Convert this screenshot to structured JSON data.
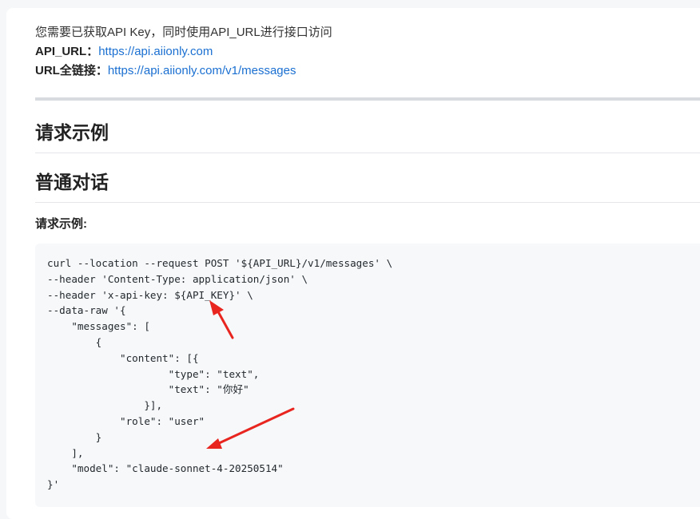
{
  "intro": {
    "line1": "您需要已获取API Key，同时使用API_URL进行接口访问",
    "api_url_label": "API_URL：",
    "api_url_link": "https://api.aiionly.com",
    "full_url_label": "URL全链接：",
    "full_url_link": "https://api.aiionly.com/v1/messages"
  },
  "headings": {
    "request_example": "请求示例",
    "normal_chat": "普通对话"
  },
  "sublabel": "请求示例:",
  "code": {
    "lines": [
      "curl --location --request POST '${API_URL}/v1/messages' \\",
      "--header 'Content-Type: application/json' \\",
      "--header 'x-api-key: ${API_KEY}' \\",
      "--data-raw '{",
      "    \"messages\": [",
      "        {",
      "            \"content\": [{",
      "                    \"type\": \"text\",",
      "                    \"text\": \"你好\"",
      "                }],",
      "            \"role\": \"user\"",
      "        }",
      "    ],",
      "    \"model\": \"claude-sonnet-4-20250514\"",
      "}'"
    ]
  },
  "colors": {
    "link": "#1a6fd1",
    "arrow": "#e8251f",
    "code_bg": "#f6f8fa"
  }
}
